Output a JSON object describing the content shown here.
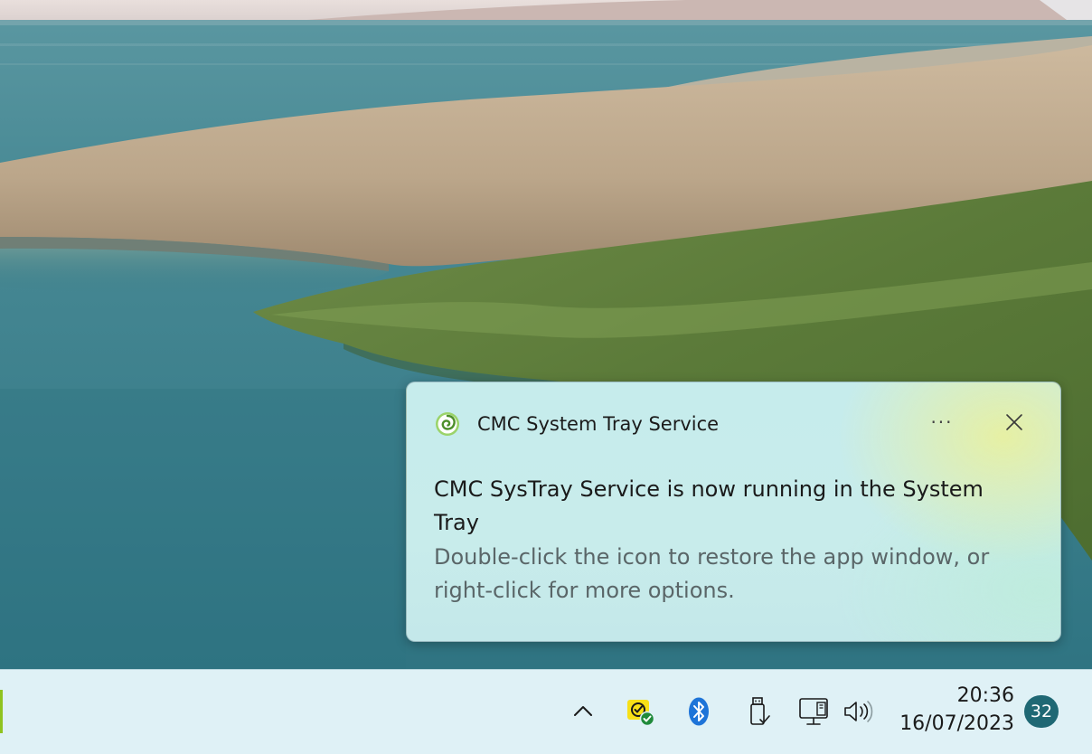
{
  "notification": {
    "app_name": "CMC System Tray Service",
    "app_icon": "cmc-spiral-icon",
    "more_label": "···",
    "close_icon": "close-icon",
    "title": "CMC SysTray Service is now running in the System Tray",
    "body": "Double-click the icon to restore the app window, or right-click for more options."
  },
  "taskbar": {
    "tray_icons": [
      "chevron-up-icon",
      "security-check-icon",
      "bluetooth-icon",
      "usb-drive-icon",
      "network-monitor-icon",
      "speaker-volume-icon"
    ],
    "clock": {
      "time": "20:36",
      "date": "16/07/2023"
    },
    "notification_badge": "32"
  },
  "colors": {
    "taskbar_bg": "#dff1f6",
    "badge_bg": "#1f6874",
    "toast_bg": "#c6ecec",
    "toast_highlight": "#e8f0a0",
    "bluetooth": "#1e74d8",
    "security_yellow": "#f7e017",
    "security_green": "#1f8a3a"
  }
}
